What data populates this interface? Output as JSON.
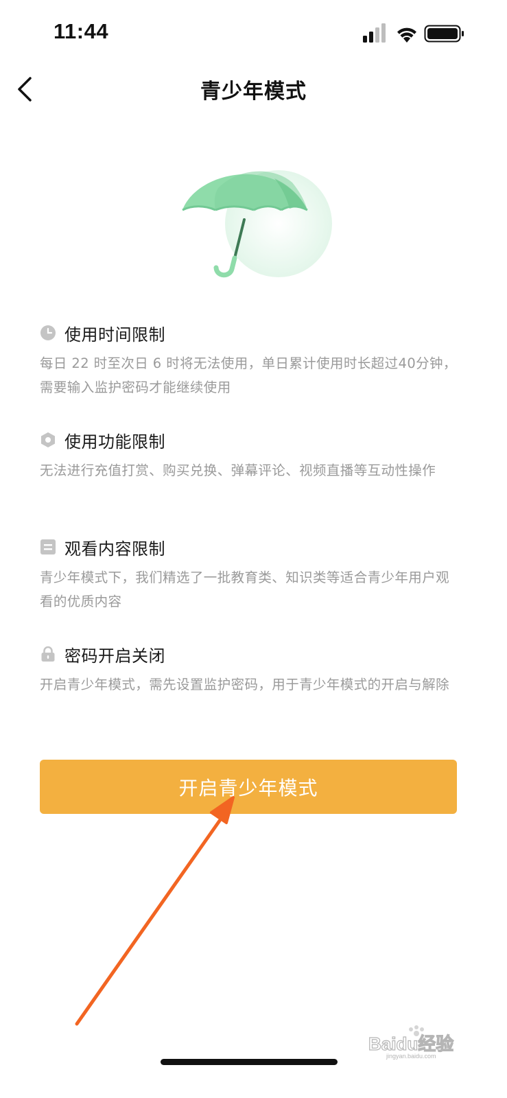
{
  "status_bar": {
    "time": "11:44",
    "icons": [
      "signal-icon",
      "wifi-icon",
      "battery-icon"
    ]
  },
  "nav": {
    "title": "青少年模式",
    "back_icon": "chevron-left-icon"
  },
  "hero": {
    "icon": "umbrella-illustration",
    "colors": {
      "canopy": "#8fdcaa",
      "canopy_dark": "#6fc890",
      "handle": "#3e7a55",
      "glow": "#e6f7ec"
    }
  },
  "features": [
    {
      "icon": "clock-icon",
      "title": "使用时间限制",
      "description": "每日 22 时至次日 6 时将无法使用，单日累计使用时长超过40分钟，需要输入监护密码才能继续使用"
    },
    {
      "icon": "hexagon-icon",
      "title": "使用功能限制",
      "description": "无法进行充值打赏、购买兑换、弹幕评论、视频直播等互动性操作"
    },
    {
      "icon": "content-icon",
      "title": "观看内容限制",
      "description": "青少年模式下，我们精选了一批教育类、知识类等适合青少年用户观看的优质内容"
    },
    {
      "icon": "lock-icon",
      "title": "密码开启关闭",
      "description": "开启青少年模式，需先设置监护密码，用于青少年模式的开启与解除"
    }
  ],
  "primary_button": {
    "label": "开启青少年模式",
    "color": "#f3b040"
  },
  "annotation": {
    "icon": "arrow-annotation",
    "color": "#f26522"
  },
  "watermark": {
    "text": "Baidu经验",
    "subtext": "jingyan.baidu.com"
  },
  "colors": {
    "title_text": "#111111",
    "feature_title": "#1a1a1a",
    "feature_desc": "#9a9a9a",
    "icon_gray": "#c4c4c4"
  }
}
